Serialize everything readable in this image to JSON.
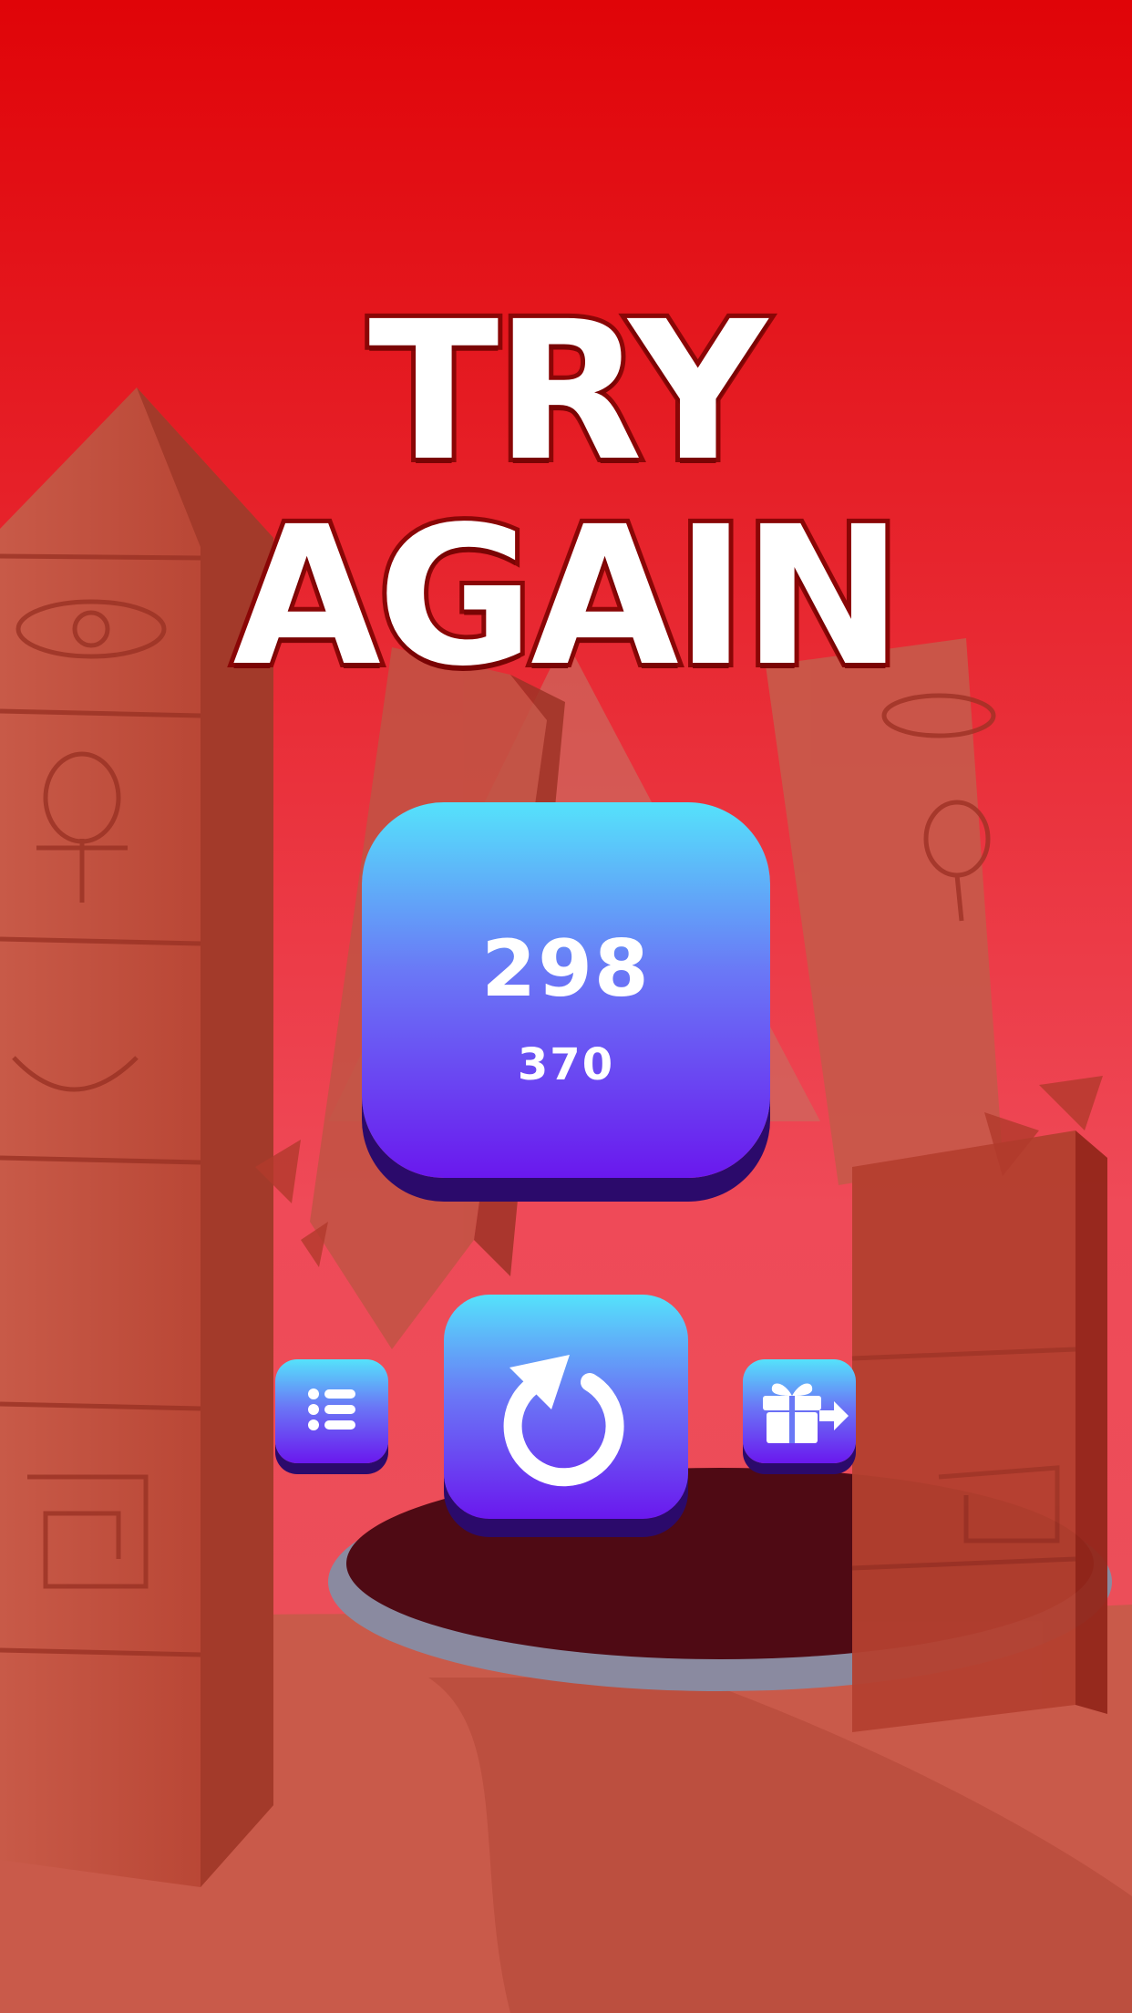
{
  "header": {
    "line1": "TRY",
    "line2": "AGAIN"
  },
  "score": {
    "current": "298",
    "best": "370"
  },
  "buttons": {
    "retry_icon": "restart-arrow-icon",
    "leaderboard_icon": "list-icon",
    "gift_icon": "gift-icon"
  },
  "colors": {
    "sky_top": "#e00408",
    "sky_bottom": "#ef4a58",
    "button_top": "#55e2fb",
    "button_bottom": "#6a18ee",
    "title_outline": "#8a0606"
  }
}
